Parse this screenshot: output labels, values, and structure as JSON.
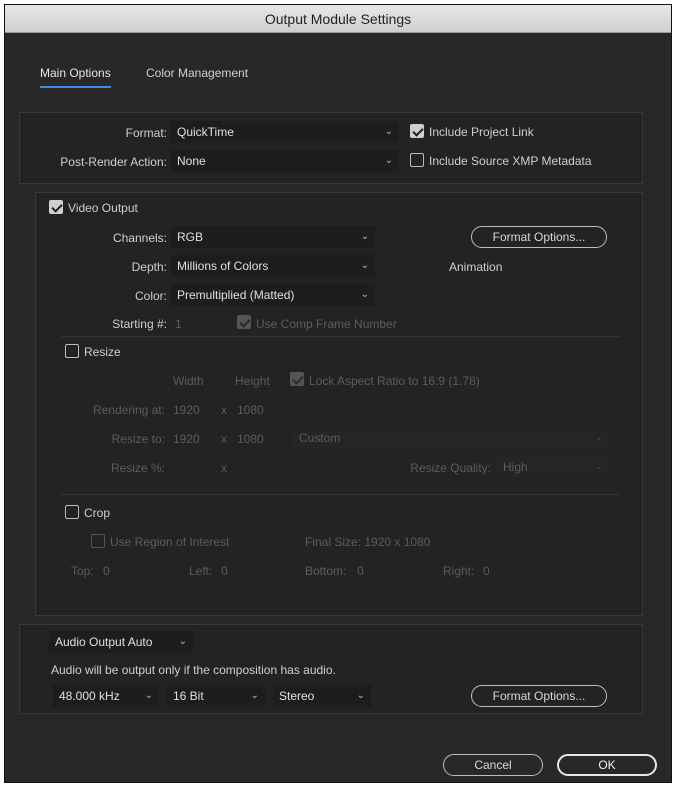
{
  "window": {
    "title": "Output Module Settings"
  },
  "tabs": [
    {
      "label": "Main Options",
      "active": true
    },
    {
      "label": "Color Management",
      "active": false
    }
  ],
  "format": {
    "label": "Format:",
    "value": "QuickTime",
    "include_project_link": {
      "label": "Include Project Link",
      "checked": true
    }
  },
  "post_render": {
    "label": "Post-Render Action:",
    "value": "None",
    "include_xmp": {
      "label": "Include Source XMP Metadata",
      "checked": false
    }
  },
  "video": {
    "output_label": "Video Output",
    "output_checked": true,
    "channels_label": "Channels:",
    "channels_value": "RGB",
    "depth_label": "Depth:",
    "depth_value": "Millions of Colors",
    "color_label": "Color:",
    "color_value": "Premultiplied (Matted)",
    "starting_label": "Starting #:",
    "starting_value": "1",
    "use_comp_frame_label": "Use Comp Frame Number",
    "use_comp_frame_checked": true,
    "format_options_label": "Format Options...",
    "codec_info": "Animation"
  },
  "resize": {
    "label": "Resize",
    "checked": false,
    "width_header": "Width",
    "height_header": "Height",
    "lock_aspect_label": "Lock Aspect Ratio to 16:9 (1.78)",
    "lock_aspect_checked": true,
    "rendering_at_label": "Rendering at:",
    "rendering_w": "1920",
    "rendering_x": "x",
    "rendering_h": "1080",
    "resize_to_label": "Resize to:",
    "resize_to_w": "1920",
    "resize_to_x": "x",
    "resize_to_h": "1080",
    "preset_value": "Custom",
    "resize_pct_label": "Resize %:",
    "resize_pct_x": "x",
    "quality_label": "Resize Quality:",
    "quality_value": "High"
  },
  "crop": {
    "label": "Crop",
    "checked": false,
    "roi_label": "Use Region of Interest",
    "roi_checked": false,
    "final_size": "Final Size: 1920 x 1080",
    "top_label": "Top:",
    "top_value": "0",
    "left_label": "Left:",
    "left_value": "0",
    "bottom_label": "Bottom:",
    "bottom_value": "0",
    "right_label": "Right:",
    "right_value": "0"
  },
  "audio": {
    "mode_value": "Audio Output Auto",
    "note": "Audio will be output only if the composition has audio.",
    "rate_value": "48.000 kHz",
    "bits_value": "16 Bit",
    "channels_value": "Stereo",
    "format_options_label": "Format Options..."
  },
  "footer": {
    "cancel_label": "Cancel",
    "ok_label": "OK"
  },
  "icons": {
    "dropdown": "chevron-down-icon",
    "check": "checkmark-icon"
  }
}
